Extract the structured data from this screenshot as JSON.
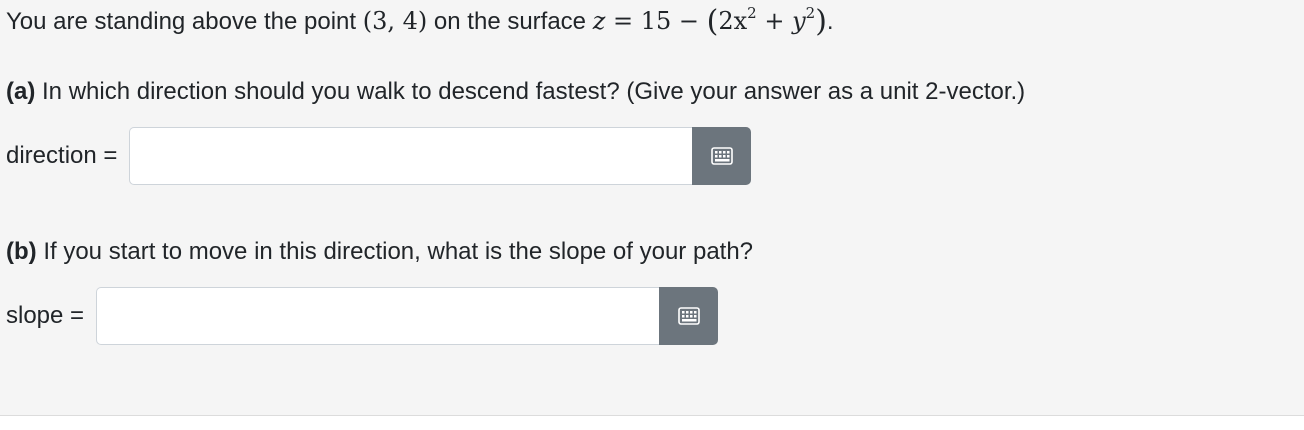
{
  "problem": {
    "intro_prefix": "You are standing above the point ",
    "point": "(3, 4)",
    "intro_middle": " on the surface ",
    "surface": {
      "lhs": "z",
      "eq_rest": " = 15 − ",
      "open_paren": "(",
      "term1": "2x",
      "exp1": "2",
      "plus": " + ",
      "term2": "y",
      "exp2": "2",
      "close_paren": ")"
    },
    "intro_suffix": ".",
    "part_a": {
      "tag": "(a)",
      "text": " In which direction should you walk to descend fastest? (Give your answer as a unit 2-vector.)",
      "answer_label": "direction =",
      "answer_value": ""
    },
    "part_b": {
      "tag": "(b)",
      "text": " If you start to move in this direction, what is the slope of your path?",
      "answer_label": "slope =",
      "answer_value": ""
    },
    "keyboard_icon": "keyboard-icon",
    "colors": {
      "background": "#f5f5f5",
      "button": "#6c757d",
      "input_border": "#ced4da"
    }
  }
}
